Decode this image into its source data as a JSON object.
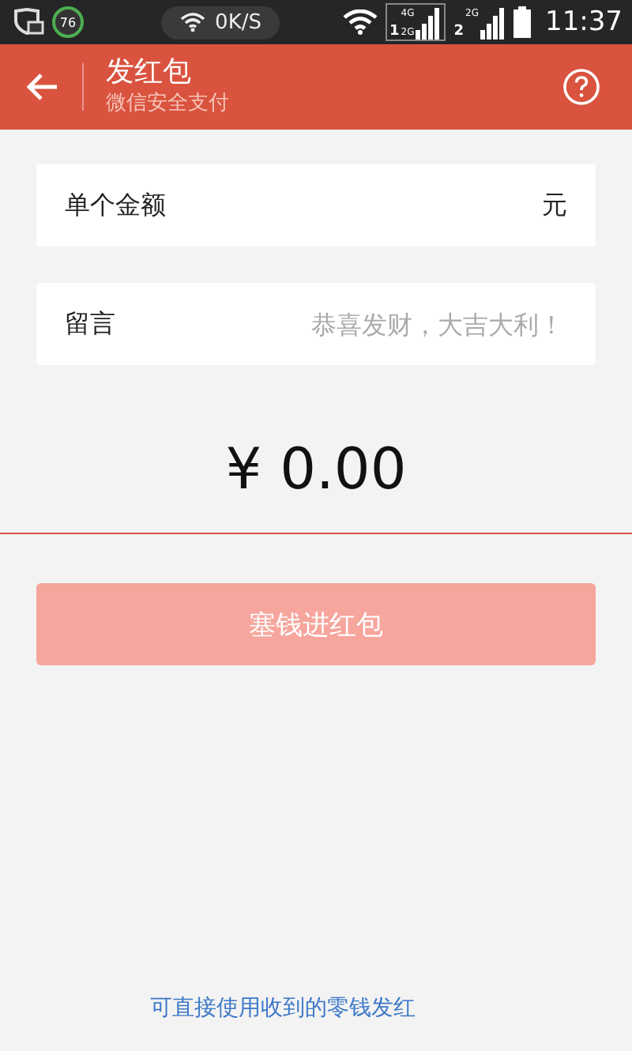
{
  "status_bar": {
    "badge": "76",
    "speed": "0K/S",
    "sim1": {
      "network": "4G",
      "slot": "1",
      "network2": "2G"
    },
    "sim2": {
      "network": "2G",
      "slot": "2"
    },
    "time": "11:37"
  },
  "header": {
    "title": "发红包",
    "subtitle": "微信安全支付"
  },
  "fields": [
    {
      "label": "单个金额",
      "unit": "元"
    },
    {
      "label": "留言",
      "placeholder": "恭喜发财，大吉大利！"
    }
  ],
  "amount": "¥ 0.00",
  "submit": {
    "label": "塞钱进红包",
    "disabled": true
  },
  "footer_link": "可直接使用收到的零钱发红"
}
